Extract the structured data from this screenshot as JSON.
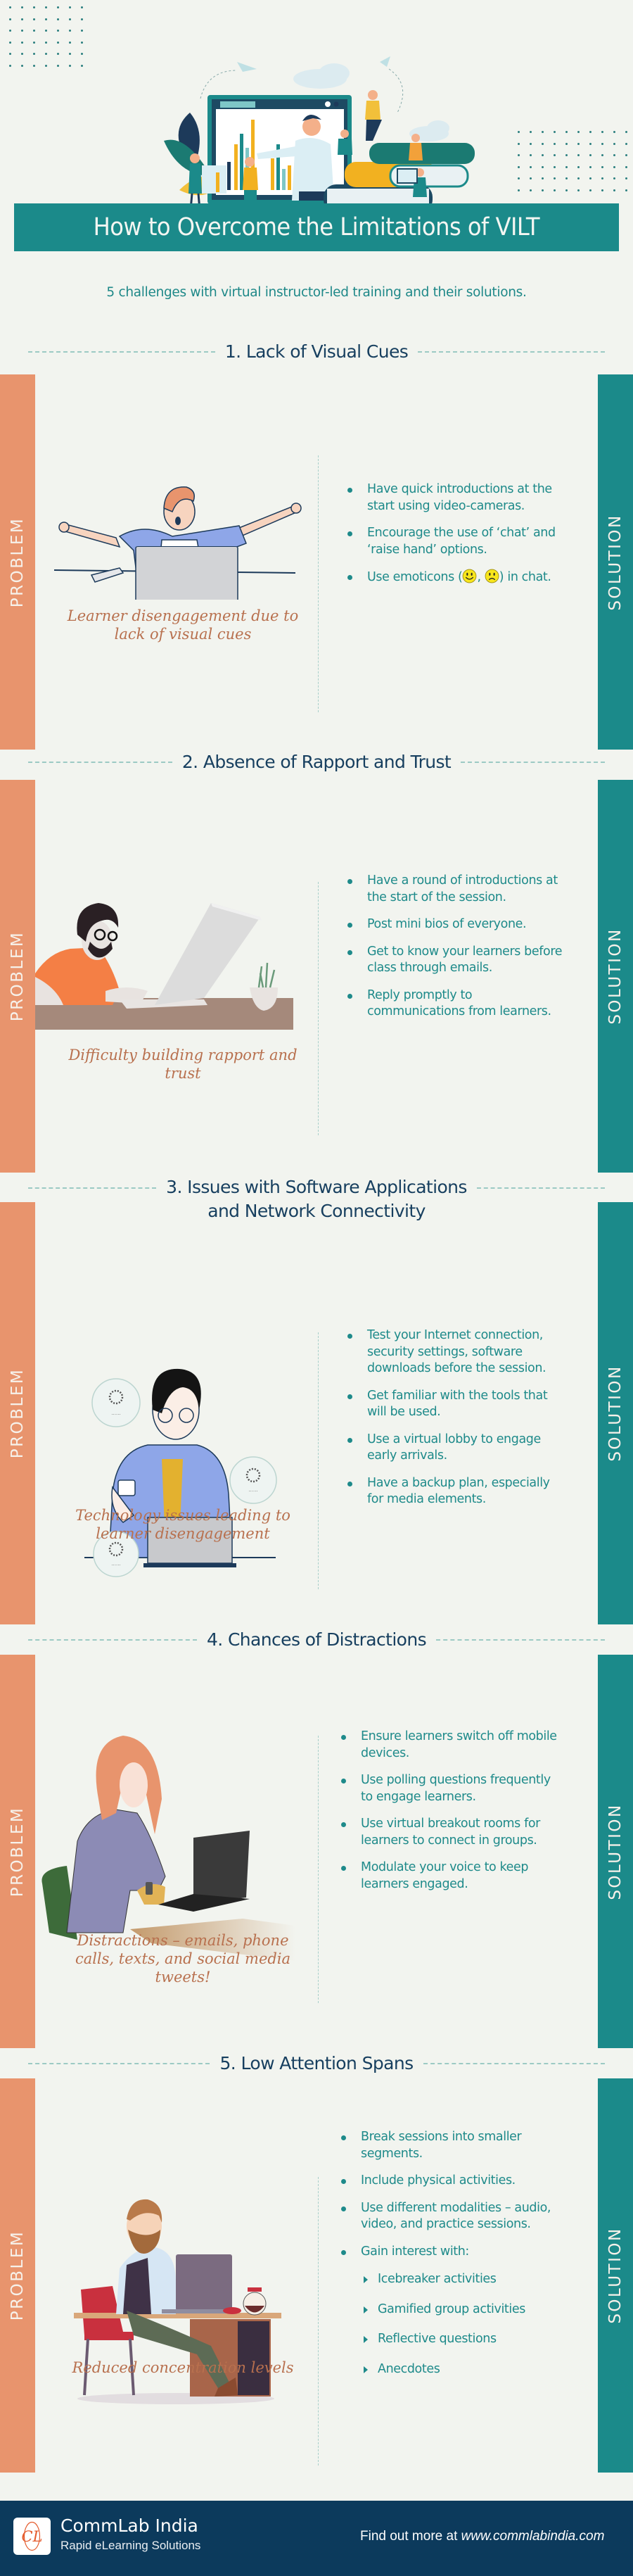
{
  "header": {
    "title": "How to Overcome the Limitations of VILT",
    "subtitle": "5 challenges with virtual instructor-led training and their solutions."
  },
  "labels": {
    "problem": "PROBLEM",
    "solution": "SOLUTION"
  },
  "sections": [
    {
      "heading": "1. Lack of Visual Cues",
      "problem_caption": "Learner disengagement due to lack of visual cues",
      "illustration": "stretching-man-at-laptop-illustration",
      "solutions": [
        {
          "text": "Have quick introductions at the start using video-cameras."
        },
        {
          "text": "Encourage the use of ‘chat’ and ‘raise hand’ options."
        },
        {
          "text_before": "Use emoticons (",
          "emoji_1": "smiley-face-icon",
          "separator": ", ",
          "emoji_2": "sad-face-icon",
          "text_after": ") in chat."
        }
      ]
    },
    {
      "heading": "2. Absence of Rapport and Trust",
      "problem_caption": "Difficulty building rapport and trust",
      "illustration": "bearded-man-with-laptop-illustration",
      "solutions": [
        {
          "text": "Have a round of introductions at the start of the session."
        },
        {
          "text": "Post mini bios of everyone."
        },
        {
          "text": "Get to know your learners before class through emails."
        },
        {
          "text": "Reply promptly to communications from learners."
        }
      ]
    },
    {
      "heading_line1": "3. Issues with Software Applications",
      "heading_line2": "and Network Connectivity",
      "problem_caption": "Technology issues leading to learner disengagement",
      "illustration": "man-with-coffee-and-loading-spinners-illustration",
      "solutions": [
        {
          "text": "Test your Internet connection, security settings, software downloads before the session."
        },
        {
          "text": "Get familiar with the tools that will be used."
        },
        {
          "text": "Use a virtual lobby to engage early arrivals."
        },
        {
          "text": "Have a backup plan, especially for media elements."
        }
      ]
    },
    {
      "heading": "4. Chances of Distractions",
      "problem_caption": "Distractions – emails, phone calls, texts, and social media tweets!",
      "illustration": "woman-on-phone-at-laptop-illustration",
      "solutions": [
        {
          "text": "Ensure learners switch off mobile devices."
        },
        {
          "text": "Use polling questions frequently to engage learners."
        },
        {
          "text": "Use virtual breakout rooms for learners to connect in groups."
        },
        {
          "text": "Modulate your voice to keep learners engaged."
        }
      ]
    },
    {
      "heading": "5. Low Attention Spans",
      "problem_caption": "Reduced concentration levels",
      "illustration": "bearded-man-at-desk-illustration",
      "solutions": [
        {
          "text": "Break sessions into smaller segments."
        },
        {
          "text": "Include physical activities."
        },
        {
          "text": "Use different modalities – audio, video, and practice sessions."
        },
        {
          "text": "Gain interest with:",
          "sub_items": [
            "Icebreaker activities",
            "Gamified group activities",
            "Reflective questions",
            "Anecdotes"
          ]
        }
      ]
    }
  ],
  "footer": {
    "logo_mark": "CL",
    "brand_name": "CommLab India",
    "brand_tagline": "Rapid eLearning Solutions",
    "more_prefix": "Find out more at ",
    "more_url": "www.commlabindia.com"
  },
  "colors": {
    "background": "#f2f4ef",
    "teal": "#1b8a8a",
    "problem_orange": "#e8946d",
    "heading_navy": "#173f5f",
    "caption_brown": "#b8704e",
    "footer_navy": "#0c3a5c"
  }
}
